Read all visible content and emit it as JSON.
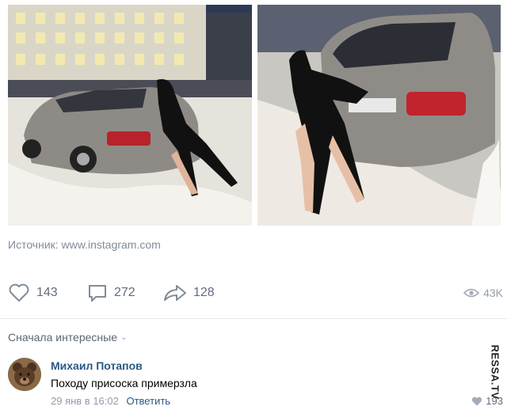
{
  "post": {
    "photos": [
      {
        "name": "photo-1"
      },
      {
        "name": "photo-2"
      }
    ],
    "source": "Источник: www.instagram.com",
    "likes": "143",
    "comments": "272",
    "shares": "128",
    "views": "43K"
  },
  "comments_section": {
    "sort_label": "Сначала интересные"
  },
  "comment": {
    "author": "Михаил Потапов",
    "text": "Походу присоска примерзла",
    "date": "29 янв в 16:02",
    "reply": "Ответить",
    "likes": "193"
  },
  "watermark": "RESSA.TV",
  "icons": {
    "like": "heart-icon",
    "comment": "comment-icon",
    "share": "share-icon",
    "views": "eye-icon",
    "sort": "chevron-down-icon"
  },
  "colors": {
    "link": "#2a5885",
    "muted": "#818c99",
    "action": "#626d7a",
    "divider": "#e7e8ec"
  }
}
